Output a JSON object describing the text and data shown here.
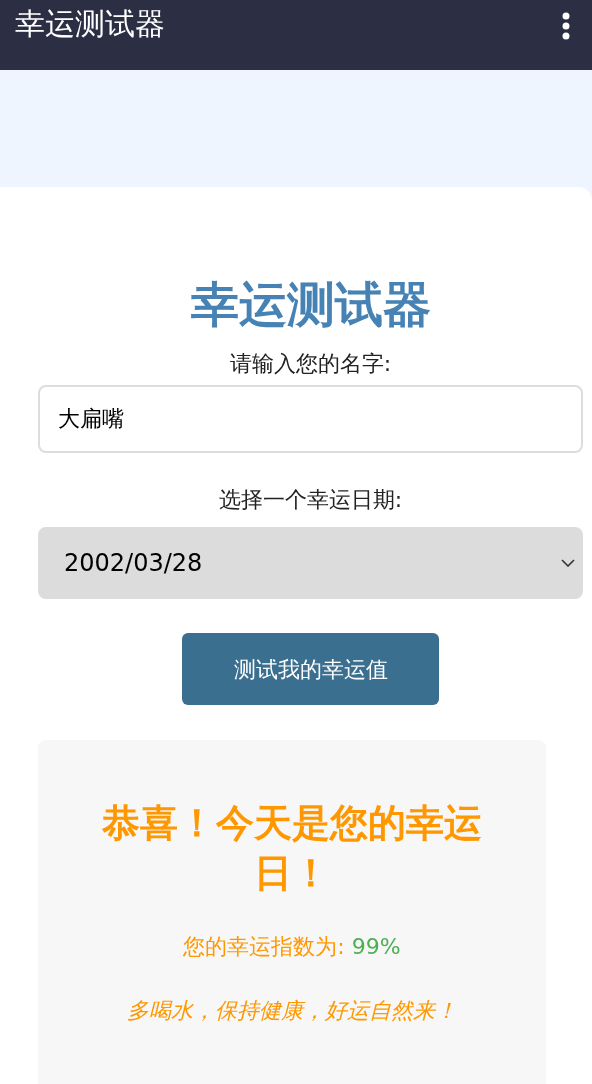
{
  "app_bar": {
    "title": "幸运测试器"
  },
  "form": {
    "title": "幸运测试器",
    "name_label": "请输入您的名字:",
    "name_value": "大扁嘴",
    "date_label": "选择一个幸运日期:",
    "date_value": "2002/03/28",
    "button": "测试我的幸运值"
  },
  "result": {
    "title": "恭喜！今天是您的幸运日！",
    "score_label": "您的幸运指数为: ",
    "score_value": "99%",
    "tip": "多喝水，保持健康，好运自然来！"
  }
}
